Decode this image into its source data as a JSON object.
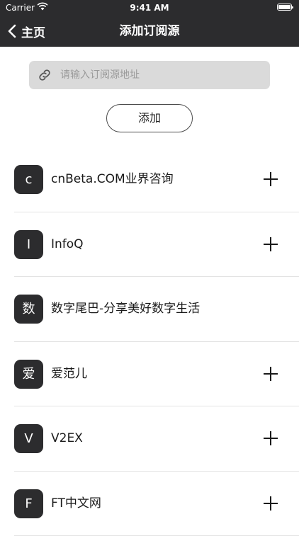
{
  "status_bar": {
    "carrier": "Carrier",
    "time": "9:41 AM"
  },
  "nav": {
    "back_label": "主页",
    "title": "添加订阅源"
  },
  "search": {
    "placeholder": "请输入订阅源地址",
    "value": ""
  },
  "add_button_label": "添加",
  "feeds": [
    {
      "initial": "c",
      "title": "cnBeta.COM业界咨询",
      "show_add": true
    },
    {
      "initial": "I",
      "title": "InfoQ",
      "show_add": true
    },
    {
      "initial": "数",
      "title": "数字尾巴-分享美好数字生活",
      "show_add": false
    },
    {
      "initial": "爱",
      "title": "爱范儿",
      "show_add": true
    },
    {
      "initial": "V",
      "title": "V2EX",
      "show_add": true
    },
    {
      "initial": "F",
      "title": "FT中文网",
      "show_add": true
    }
  ],
  "colors": {
    "header_bg": "#2c2c2e",
    "avatar_bg": "#2c2c2e",
    "search_bg": "#dadada"
  }
}
